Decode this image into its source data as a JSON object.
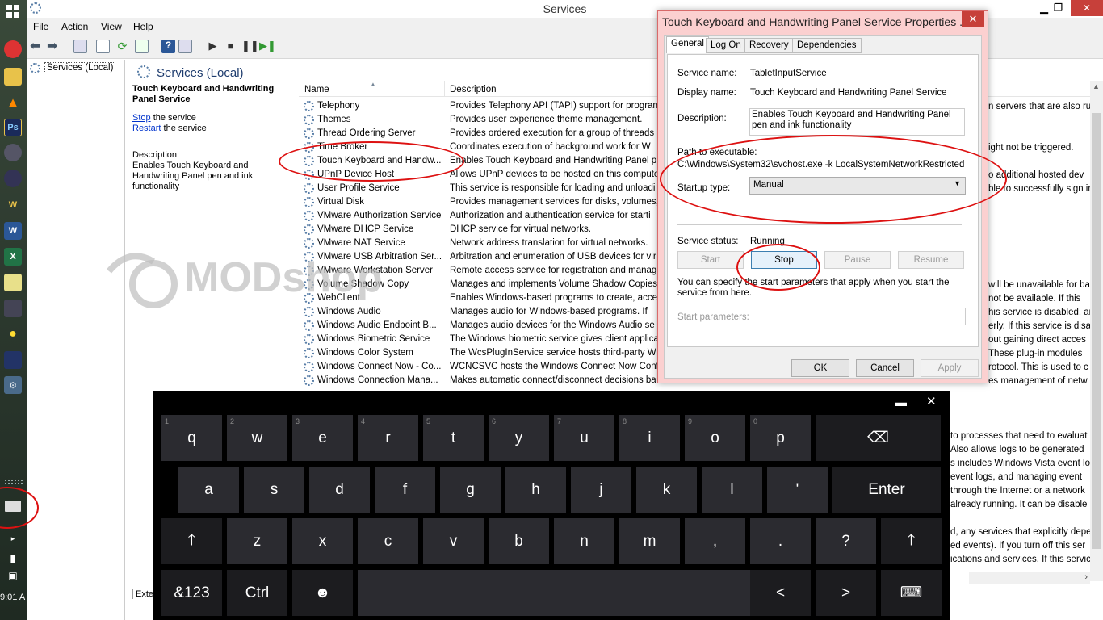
{
  "window": {
    "title": "Services"
  },
  "menu": [
    "File",
    "Action",
    "View",
    "Help"
  ],
  "tree": {
    "root_label": "Services (Local)"
  },
  "header": {
    "title": "Services (Local)"
  },
  "left_panel": {
    "service_title": "Touch Keyboard and Handwriting Panel Service",
    "stop_link": "Stop",
    "stop_suffix": " the service",
    "restart_link": "Restart",
    "restart_suffix": " the service",
    "desc_label": "Description:",
    "desc_text": "Enables Touch Keyboard and Handwriting Panel pen and ink functionality"
  },
  "columns": {
    "name": "Name",
    "description": "Description"
  },
  "services": [
    {
      "name": "Telephony",
      "desc": "Provides Telephony API (TAPI) support for program"
    },
    {
      "name": "Themes",
      "desc": "Provides user experience theme management."
    },
    {
      "name": "Thread Ordering Server",
      "desc": "Provides ordered execution for a group of threads"
    },
    {
      "name": "Time Broker",
      "desc": "Coordinates execution of background work for W"
    },
    {
      "name": "Touch Keyboard and Handw...",
      "desc": "Enables Touch Keyboard and Handwriting Panel p"
    },
    {
      "name": "UPnP Device Host",
      "desc": "Allows UPnP devices to be hosted on this compute"
    },
    {
      "name": "User Profile Service",
      "desc": "This service is responsible for loading and unloadi"
    },
    {
      "name": "Virtual Disk",
      "desc": "Provides management services for disks, volumes, "
    },
    {
      "name": "VMware Authorization Service",
      "desc": "Authorization and authentication service for starti"
    },
    {
      "name": "VMware DHCP Service",
      "desc": "DHCP service for virtual networks."
    },
    {
      "name": "VMware NAT Service",
      "desc": "Network address translation for virtual networks."
    },
    {
      "name": "VMware USB Arbitration Ser...",
      "desc": "Arbitration and enumeration of USB devices for vir"
    },
    {
      "name": "VMware Workstation Server",
      "desc": "Remote access service for registration and manage"
    },
    {
      "name": "Volume Shadow Copy",
      "desc": "Manages and implements Volume Shadow Copies"
    },
    {
      "name": "WebClient",
      "desc": "Enables Windows-based programs to create, acces"
    },
    {
      "name": "Windows Audio",
      "desc": "Manages audio for Windows-based programs.  If "
    },
    {
      "name": "Windows Audio Endpoint B...",
      "desc": "Manages audio devices for the Windows Audio se"
    },
    {
      "name": "Windows Biometric Service",
      "desc": "The Windows biometric service gives client applica"
    },
    {
      "name": "Windows Color System",
      "desc": "The WcsPlugInService service hosts third-party W"
    },
    {
      "name": "Windows Connect Now - Co...",
      "desc": "WCNCSVC hosts the Windows Connect Now Conf"
    },
    {
      "name": "Windows Connection Mana...",
      "desc": "Makes automatic connect/disconnect decisions ba"
    }
  ],
  "right_fragments": [
    "n servers that are also ru",
    "ight not be triggered.",
    "o additional hosted dev",
    "ble to successfully sign in",
    "will be unavailable for ba",
    "not be available. If this",
    "his service is disabled, an",
    "erly.  If this service is disa",
    "out gaining direct acces",
    "These plug-in modules",
    "rotocol. This is used to c",
    "es management of netw",
    "to processes that need to evaluat",
    "Also allows logs to be generated",
    "s includes Windows Vista event lo",
    "event logs, and managing event",
    "through the Internet or a network",
    "already running. It can be disable",
    "d, any services that explicitly depe",
    "ed events).  If you turn off this ser",
    "ications and services. If this servic"
  ],
  "bottom_tab": "Exte",
  "watermark": "MODshop",
  "dialog": {
    "title": "Touch Keyboard and Handwriting Panel Service Properties ...",
    "tabs": [
      "General",
      "Log On",
      "Recovery",
      "Dependencies"
    ],
    "service_name_label": "Service name:",
    "service_name": "TabletInputService",
    "display_name_label": "Display name:",
    "display_name": "Touch Keyboard and Handwriting Panel Service",
    "description_label": "Description:",
    "description": "Enables Touch Keyboard and Handwriting Panel pen and ink functionality",
    "path_label": "Path to executable:",
    "path": "C:\\Windows\\System32\\svchost.exe -k LocalSystemNetworkRestricted",
    "startup_label": "Startup type:",
    "startup_value": "Manual",
    "status_label": "Service status:",
    "status_value": "Running",
    "btn_start": "Start",
    "btn_stop": "Stop",
    "btn_pause": "Pause",
    "btn_resume": "Resume",
    "params_note": "You can specify the start parameters that apply when you start the service from here.",
    "params_label": "Start parameters:",
    "btn_ok": "OK",
    "btn_cancel": "Cancel",
    "btn_apply": "Apply",
    "close_glyph": "✕"
  },
  "keyboard": {
    "row1": [
      {
        "k": "q",
        "n": "1"
      },
      {
        "k": "w",
        "n": "2"
      },
      {
        "k": "e",
        "n": "3"
      },
      {
        "k": "r",
        "n": "4"
      },
      {
        "k": "t",
        "n": "5"
      },
      {
        "k": "y",
        "n": "6"
      },
      {
        "k": "u",
        "n": "7"
      },
      {
        "k": "i",
        "n": "8"
      },
      {
        "k": "o",
        "n": "9"
      },
      {
        "k": "p",
        "n": "0"
      }
    ],
    "row2": [
      "a",
      "s",
      "d",
      "f",
      "g",
      "h",
      "j",
      "k",
      "l",
      "'"
    ],
    "enter": "Enter",
    "row3": [
      "z",
      "x",
      "c",
      "v",
      "b",
      "n",
      "m",
      ",",
      ".",
      "?"
    ],
    "sym": "&123",
    "ctrl": "Ctrl",
    "shift_glyph": "🡑",
    "left_glyph": "<",
    "right_glyph": ">"
  },
  "clock": "9:01 A",
  "colors": {
    "accent_red": "#d11111",
    "dialog_frame": "#fbd0d0",
    "keyboard_key": "#2b2b30"
  }
}
